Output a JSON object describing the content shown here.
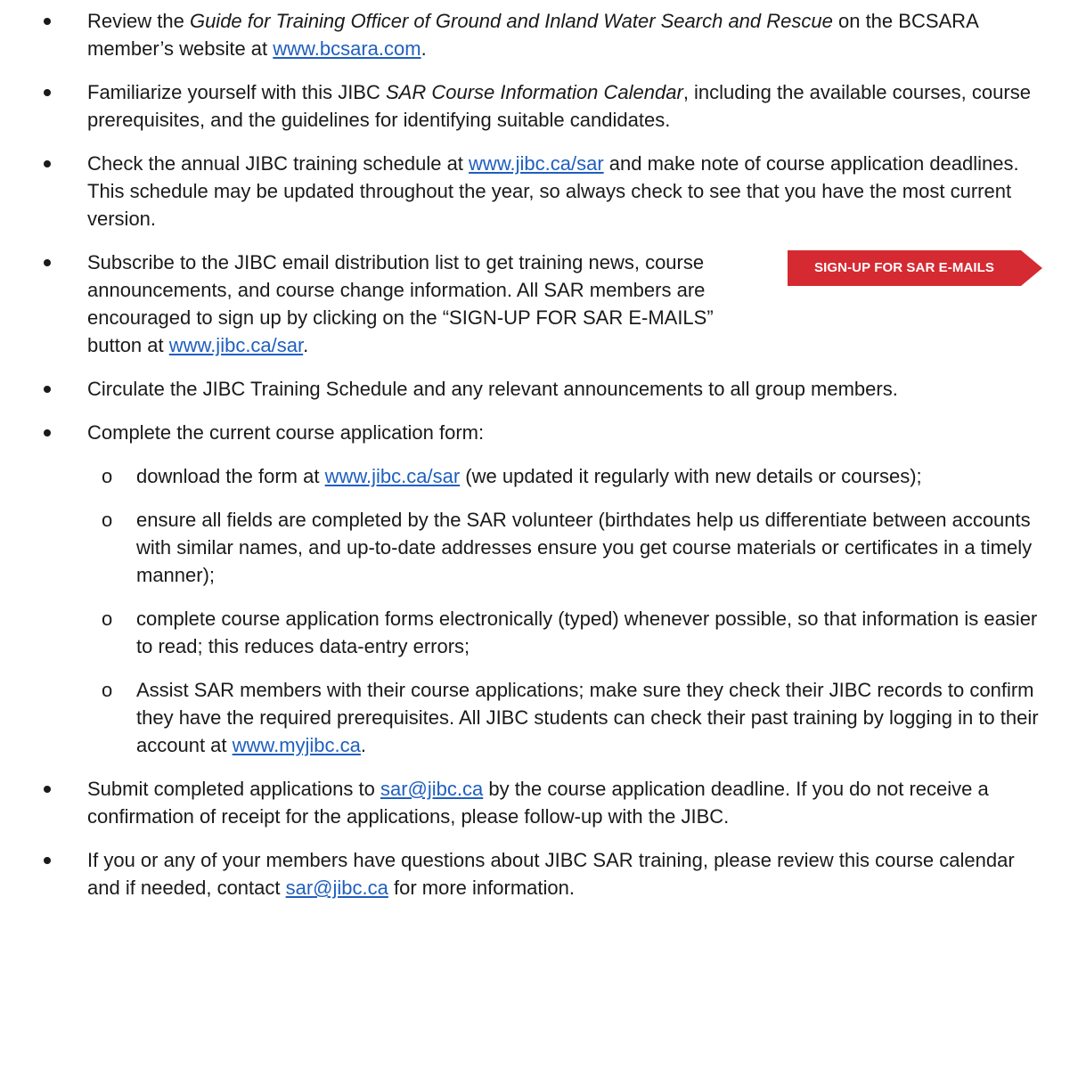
{
  "items": [
    {
      "a": "Review the ",
      "a_em": "Guide for Training Officer of Ground and Inland Water Search and Rescue",
      "b": " on the BCSARA member’s website at ",
      "link": "www.bcsara.com",
      "c": "."
    },
    {
      "a": "Familiarize yourself with this JIBC ",
      "a_em": "SAR Course Information Calendar",
      "b": ", including the available courses, course prerequisites, and the guidelines for identifying suitable candidates."
    },
    {
      "a": "Check the annual JIBC training schedule at ",
      "link": "www.jibc.ca/sar",
      "b": " and make note of course application deadlines. This schedule may be updated throughout the year, so always check to see that you have the most current version."
    },
    {
      "a": "Subscribe to the JIBC email distribution list to get training news, course announcements, and course change information. All SAR members are encouraged to sign up by clicking on the “SIGN-UP FOR SAR E-MAILS” button at ",
      "link": "www.jibc.ca/sar",
      "b": ".",
      "button_label": "SIGN-UP FOR SAR E-MAILS"
    },
    {
      "a": "Circulate the JIBC Training Schedule and any relevant announcements to all group members."
    },
    {
      "a": "Complete the current course application form:",
      "sub": [
        {
          "marker": "o",
          "a": "download the form at ",
          "link": "www.jibc.ca/sar",
          "b": " (we updated it regularly with new details or courses);"
        },
        {
          "marker": "o",
          "a": "ensure all fields are completed by the SAR volunteer (birthdates help us differentiate between accounts with similar names, and up-to-date addresses ensure you get course materials or certificates in a timely manner);"
        },
        {
          "marker": "o",
          "a": "complete course application forms electronically (typed) whenever possible, so that information is easier to read; this reduces data-entry errors;"
        },
        {
          "marker": "o",
          "a": "Assist SAR members with their course applications; make sure they check their JIBC records to confirm they have the required prerequisites. All JIBC students can check their past training by logging in to their account at ",
          "link": "www.myjibc.ca",
          "b": "."
        }
      ]
    },
    {
      "a": "Submit completed applications to ",
      "link": "sar@jibc.ca",
      "b": " by the course application deadline. If you do not receive a confirmation of receipt for the applications, please follow-up with the JIBC."
    },
    {
      "a": "If you or any of your members have questions about JIBC SAR training, please review this course calendar and if needed, contact ",
      "link": "sar@jibc.ca",
      "b": " for more information."
    }
  ],
  "colors": {
    "link": "#1f5fbf",
    "button": "#d52a31",
    "text": "#1a1a1a"
  }
}
